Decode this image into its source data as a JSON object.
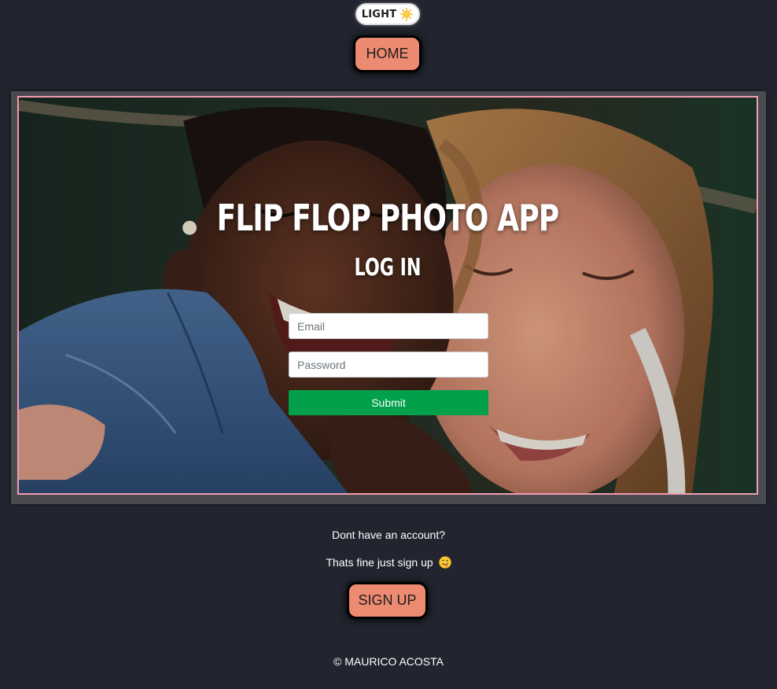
{
  "theme_toggle": {
    "label": "LIGHT",
    "icon": "sun-icon"
  },
  "nav": {
    "home_label": "HOME"
  },
  "hero": {
    "app_title": "FLIP FLOP PHOTO APP",
    "heading": "LOG IN",
    "background": "photo of two smiling women"
  },
  "login_form": {
    "email_placeholder": "Email",
    "password_placeholder": "Password",
    "submit_label": "Submit"
  },
  "signup": {
    "question": "Dont have an account?",
    "prompt": "Thats fine just sign up",
    "prompt_emoji": "winking-tongue-face-icon",
    "button_label": "SIGN UP"
  },
  "footer": {
    "text": "© MAURICO ACOSTA"
  },
  "colors": {
    "page_background": "#22252f",
    "button_accent": "#ed8a72",
    "hero_border": "#f39bb0",
    "submit_green": "#02a04a"
  }
}
